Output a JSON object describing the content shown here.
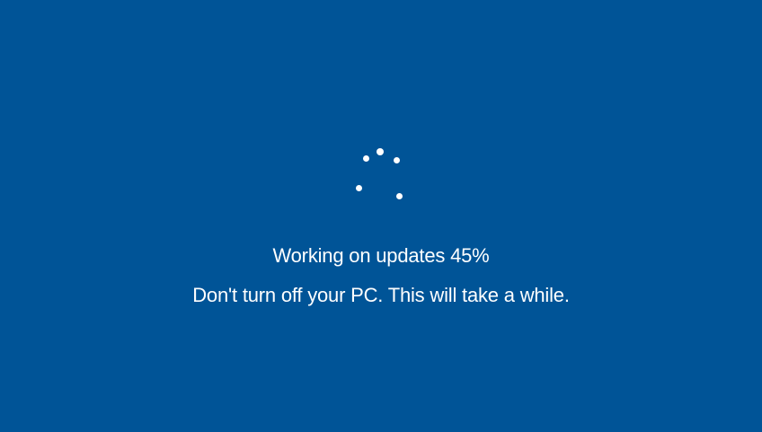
{
  "screen": {
    "background_color": "#005497",
    "text_color": "#ffffff"
  },
  "status": {
    "message": "Working on updates  45%",
    "warning": "Don't turn off your PC. This will take a while."
  },
  "progress": {
    "percent": 45
  },
  "spinner": {
    "icon": "loading-spinner-icon",
    "dot_count": 5
  }
}
